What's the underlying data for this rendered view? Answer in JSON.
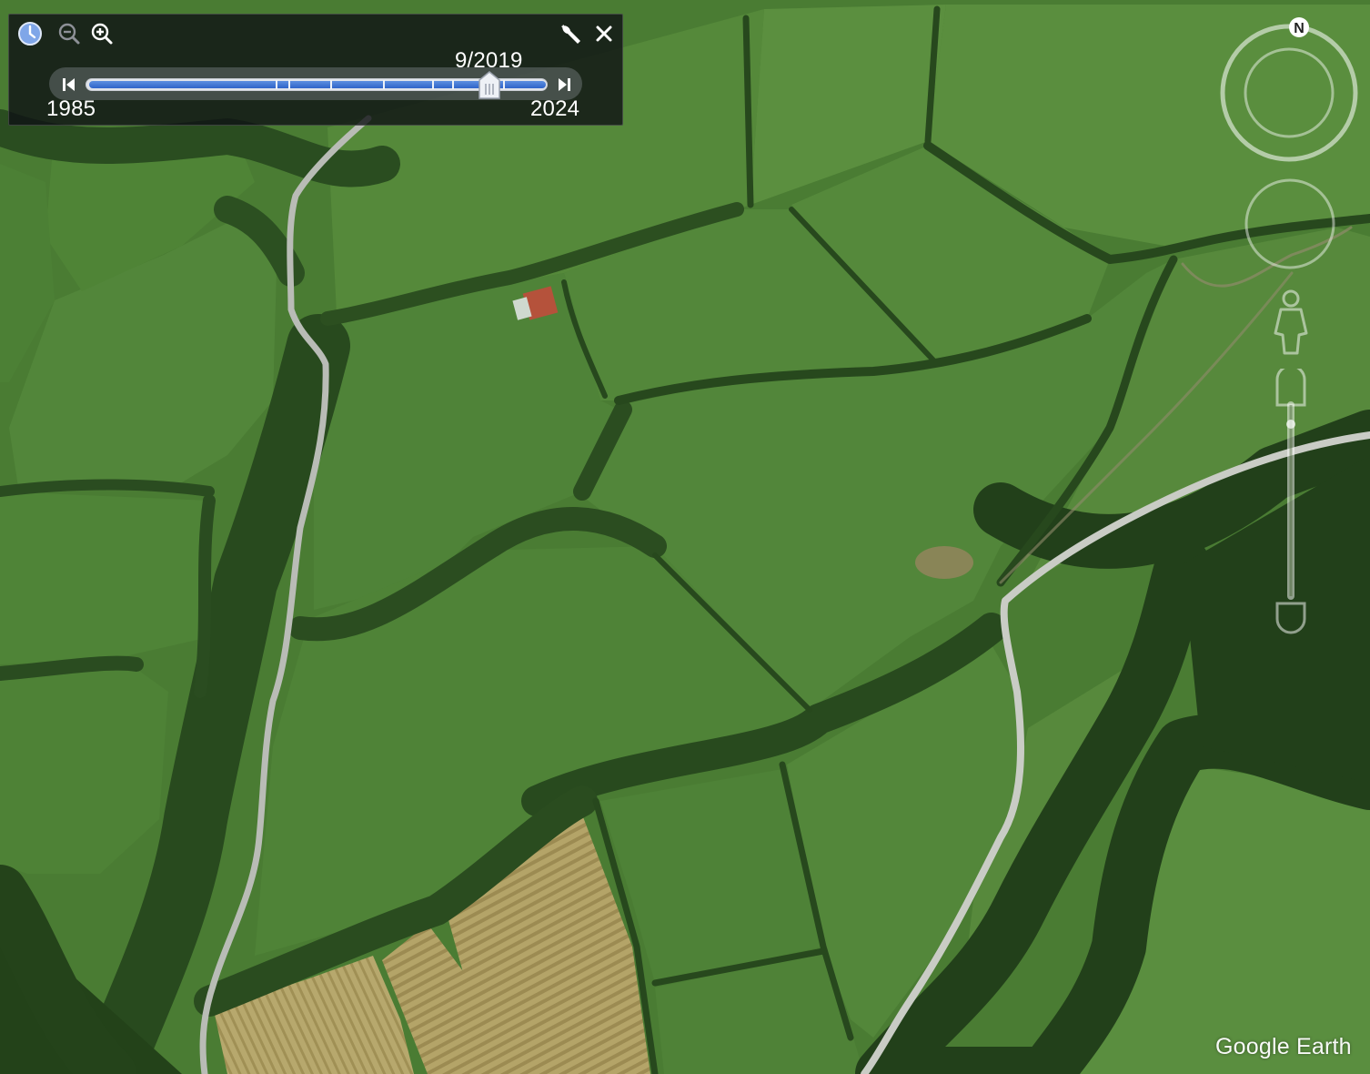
{
  "app": {
    "name": "Google Earth"
  },
  "imagery_panel": {
    "date_label": "9/2019",
    "year_start": "1985",
    "year_end": "2024",
    "position_fraction": 0.877,
    "icons": [
      "clock-icon",
      "zoom-out-icon",
      "zoom-in-icon",
      "wrench-icon",
      "close-icon",
      "skip-to-start-icon",
      "skip-to-end-icon"
    ]
  },
  "navigation": {
    "compass_letter": "N",
    "zoom_level_fraction": 0.9,
    "icons": [
      "look-joystick-icon",
      "pegman-icon",
      "zoom-slider-icon"
    ]
  },
  "attribution": {
    "logo_text": "Google Earth"
  },
  "colors": {
    "panel_bg": "#0e1014",
    "slider_fill": "#3b72d6",
    "pasture": "#4c7f34",
    "woodland": "#25461c",
    "hay": "#b0a064",
    "road": "#c7cbc4"
  }
}
